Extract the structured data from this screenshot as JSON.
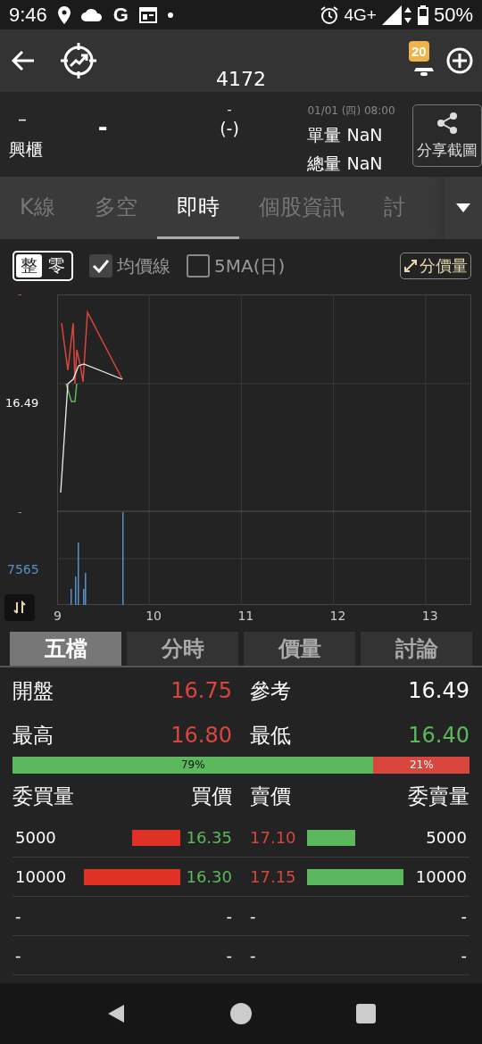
{
  "status_bar": {
    "time": "9:46",
    "app_glyph": "G",
    "network": "4G+",
    "battery": "50%"
  },
  "header": {
    "title": "4172",
    "alert_count": "20"
  },
  "quote": {
    "price": "–",
    "change": "-",
    "change_top": "-",
    "change_pct": "(-)",
    "market": "興櫃",
    "datetime": "01/01 (四) 08:00",
    "tick_volume": "單量 NaN",
    "total_volume": "總量 NaN",
    "share_button": "分享截圖"
  },
  "tabs": [
    {
      "label": "K線",
      "selected": false
    },
    {
      "label": "多空",
      "selected": false
    },
    {
      "label": "即時",
      "selected": true
    },
    {
      "label": "個股資訊",
      "selected": false
    },
    {
      "label": "討",
      "selected": false
    }
  ],
  "chart_controls": {
    "lot_toggle": [
      {
        "label": "整",
        "selected": true
      },
      {
        "label": "零",
        "selected": false
      }
    ],
    "checkboxes": [
      {
        "label": "均價線",
        "checked": true
      },
      {
        "label": "5MA(日)",
        "checked": false
      }
    ],
    "price_volume_button": "分價量"
  },
  "chart": {
    "y_top": "-",
    "y_mid": "16.49",
    "y_bottom": "-",
    "volume_label": "7565",
    "x_labels": [
      "9",
      "10",
      "11",
      "12",
      "13"
    ]
  },
  "sub_tabs": [
    {
      "label": "五檔",
      "selected": true
    },
    {
      "label": "分時",
      "selected": false
    },
    {
      "label": "價量",
      "selected": false
    },
    {
      "label": "討論",
      "selected": false
    }
  ],
  "summary": [
    {
      "label": "開盤",
      "value": "16.75",
      "color": "#d9463e"
    },
    {
      "label": "參考",
      "value": "16.49",
      "color": "#ffffff"
    },
    {
      "label": "最高",
      "value": "16.80",
      "color": "#d9463e"
    },
    {
      "label": "最低",
      "value": "16.40",
      "color": "#5cb85c"
    }
  ],
  "ratio": {
    "level": 0.79,
    "buy_label": "79%",
    "sell_label": "21%"
  },
  "book_headers": [
    "委買量",
    "買價",
    "賣價",
    "委賣量"
  ],
  "book_rows": [
    {
      "bid_qty": "5000",
      "bid_price": "16.35",
      "ask_price": "17.10",
      "ask_qty": "5000"
    },
    {
      "bid_qty": "10000",
      "bid_price": "16.30",
      "ask_price": "17.15",
      "ask_qty": "10000"
    },
    {
      "bid_qty": "-",
      "bid_price": "-",
      "ask_price": "-",
      "ask_qty": "-"
    },
    {
      "bid_qty": "-",
      "bid_price": "-",
      "ask_price": "-",
      "ask_qty": "-"
    }
  ]
}
